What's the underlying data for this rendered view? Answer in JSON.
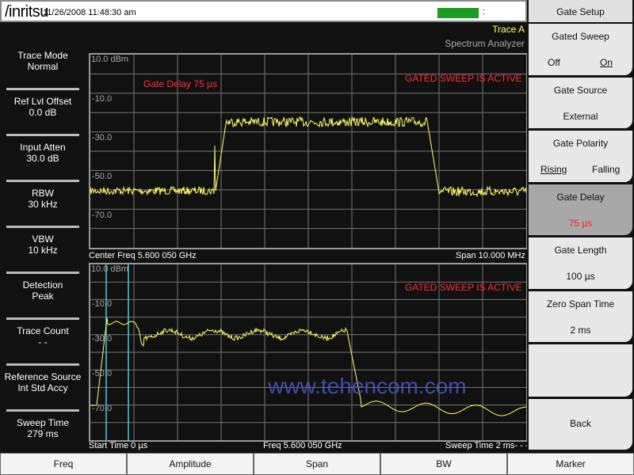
{
  "header": {
    "logo": "/inritsu",
    "datetime": "11/26/2008 11:48:30 am",
    "battery_icon": "battery-icon",
    "battery_suffix": ":",
    "trace": "Trace A",
    "mode": "Spectrum Analyzer"
  },
  "sidebar": [
    {
      "label": "Trace Mode",
      "value": "Normal"
    },
    {
      "label": "Ref Lvl Offset",
      "value": "0.0 dB"
    },
    {
      "label": "Input Atten",
      "value": "30.0 dB"
    },
    {
      "label": "RBW",
      "value": "30 kHz"
    },
    {
      "label": "VBW",
      "value": "10 kHz"
    },
    {
      "label": "Detection",
      "value": "Peak"
    },
    {
      "label": "Trace Count",
      "value": "- -"
    },
    {
      "label": "Reference Source",
      "value": "Int Std Accy"
    },
    {
      "label": "Sweep Time",
      "value": "279 ms"
    }
  ],
  "plot1": {
    "ref": "10.0 dBm",
    "ticks": [
      "-10.0",
      "-30.0",
      "-50.0",
      "-70.0"
    ],
    "gate_delay": "Gate Delay  75 µs",
    "status": "GATED SWEEP IS ACTIVE",
    "footer_left": "Center Freq 5.600 050 GHz",
    "footer_right": "Span 10.000 MHz"
  },
  "plot2": {
    "ref": "10.0 dBm",
    "ticks": [
      "-10.0",
      "-30.0",
      "-50.0",
      "-70.0"
    ],
    "status": "GATED SWEEP IS ACTIVE",
    "footer_left": "Start Time  0 µs",
    "footer_mid": "Freq 5.600 050 GHz",
    "footer_right": "Sweep Time   2 ms- - -"
  },
  "colors": {
    "trace": "#ffff66",
    "gate_marker": "#40d0e0",
    "status": "#ff3030"
  },
  "watermark": "www.tehencom.com",
  "right_panel": {
    "title": "Gate Setup",
    "gated_sweep": {
      "label": "Gated Sweep",
      "off": "Off",
      "on": "On",
      "selected": "On"
    },
    "gate_source": {
      "label": "Gate Source",
      "value": "External"
    },
    "gate_polarity": {
      "label": "Gate Polarity",
      "rising": "Rising",
      "falling": "Falling",
      "selected": "Rising"
    },
    "gate_delay": {
      "label": "Gate Delay",
      "value": "75 µs"
    },
    "gate_length": {
      "label": "Gate Length",
      "value": "100 µs"
    },
    "zero_span_time": {
      "label": "Zero Span Time",
      "value": "2 ms"
    },
    "back": "Back"
  },
  "tabs": [
    "Freq",
    "Amplitude",
    "Span",
    "BW",
    "Marker"
  ]
}
